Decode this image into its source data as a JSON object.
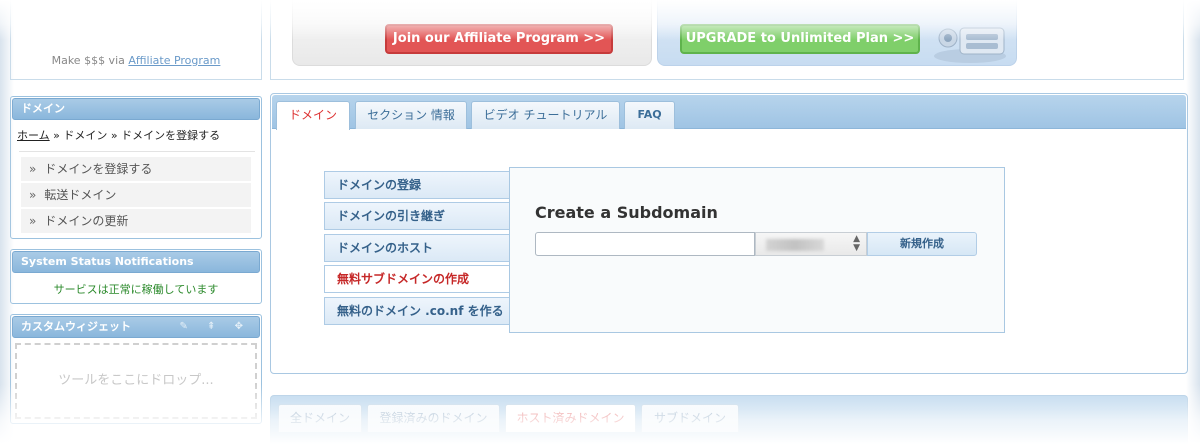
{
  "affiliate": {
    "prefix": "Make $$$ via",
    "link": "Affiliate Program"
  },
  "promos": {
    "affiliate_button": "Join our Affiliate Program >>",
    "upgrade_button": "UPGRADE to Unlimited Plan >>"
  },
  "sidebar": {
    "domain_panel": {
      "title": "ドメイン",
      "breadcrumb": {
        "home": "ホーム",
        "sep1": " » ",
        "item1": "ドメイン",
        "sep2": " » ",
        "item2": "ドメインを登録する"
      },
      "items": [
        {
          "arrow": "»",
          "label": "ドメインを登録する"
        },
        {
          "arrow": "»",
          "label": "転送ドメイン"
        },
        {
          "arrow": "»",
          "label": "ドメインの更新"
        }
      ]
    },
    "status_panel": {
      "title": "System Status Notifications",
      "message": "サービスは正常に稼働しています"
    },
    "widget_panel": {
      "title": "カスタムウィジェット",
      "tools": "✎ ⇞ ✥",
      "drop_hint": "ツールをここにドロップ..."
    }
  },
  "main": {
    "tabs": [
      {
        "label": "ドメイン"
      },
      {
        "label": "セクション 情報"
      },
      {
        "label": "ビデオ チュートリアル"
      },
      {
        "label": "FAQ"
      }
    ],
    "side_nav": [
      {
        "label": "ドメインの登録"
      },
      {
        "label": "ドメインの引き継ぎ"
      },
      {
        "label": "ドメインのホスト"
      },
      {
        "label": "無料サブドメインの作成"
      },
      {
        "label": "無料のドメイン .co.nf を作る"
      }
    ],
    "subdomain": {
      "title": "Create a Subdomain",
      "input_value": "",
      "submit_label": "新規作成"
    }
  },
  "lower_tabs": [
    {
      "label": "全ドメイン"
    },
    {
      "label": "登録済みのドメイン"
    },
    {
      "label": "ホスト済みドメイン"
    },
    {
      "label": "サブドメイン"
    }
  ],
  "colors": {
    "panel_header": "#9fc4e4",
    "active_tab_text": "#d33333",
    "status_ok": "#2c8a2c",
    "link_blue": "#35618a"
  }
}
